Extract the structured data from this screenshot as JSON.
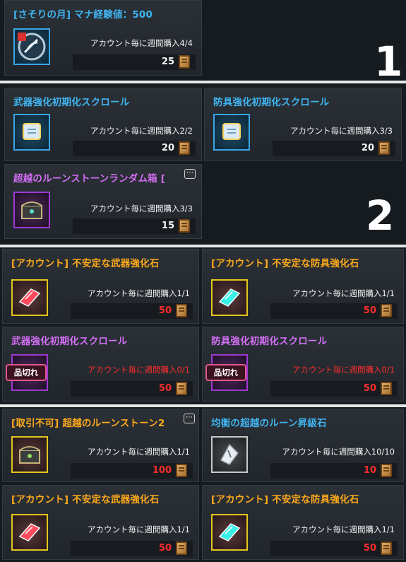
{
  "sections": [
    {
      "number": "1",
      "items": [
        {
          "title": "[さそりの月] マナ経験値：500",
          "color": "blue",
          "limit": "アカウント毎に週間購入4/4",
          "price": "25",
          "icon": "scorpion-moon-medal-icon"
        }
      ]
    },
    {
      "number": "2",
      "items": [
        {
          "title": "武器強化初期化スクロール",
          "color": "blue",
          "limit": "アカウント毎に週間購入2/2",
          "price": "20",
          "icon": "scroll-icon"
        },
        {
          "title": "防具強化初期化スクロール",
          "color": "blue",
          "limit": "アカウント毎に週間購入3/3",
          "price": "20",
          "icon": "scroll-icon"
        },
        {
          "title": "超越のルーンストーンランダム箱 [",
          "color": "purple",
          "limit": "アカウント毎に週間購入3/3",
          "price": "15",
          "icon": "treasure-chest-icon"
        }
      ]
    },
    {
      "items": [
        {
          "title": "[アカウント] 不安定な武器強化石",
          "color": "orange",
          "limit": "アカウント毎に週間購入1/1",
          "price": "50",
          "icon": "red-enhancement-stone-icon"
        },
        {
          "title": "[アカウント] 不安定な防具強化石",
          "color": "orange",
          "limit": "アカウント毎に週間購入1/1",
          "price": "50",
          "icon": "cyan-enhancement-stone-icon"
        },
        {
          "title": "武器強化初期化スクロール",
          "color": "purple",
          "limit": "アカウント毎に週間購入0/1",
          "price": "50",
          "icon": "scroll-icon",
          "sold_out": "品切れ"
        },
        {
          "title": "防具強化初期化スクロール",
          "color": "purple",
          "limit": "アカウント毎に週間購入0/1",
          "price": "50",
          "icon": "scroll-icon",
          "sold_out": "品切れ"
        }
      ]
    },
    {
      "items": [
        {
          "title": "[取引不可] 超越のルーンストーン2",
          "color": "orange",
          "limit": "アカウント毎に週間購入1/1",
          "price": "100",
          "icon": "treasure-chest-icon"
        },
        {
          "title": "均衡の超越のルーン昇級石",
          "color": "blue",
          "limit": "アカウント毎に週間購入10/10",
          "price": "10",
          "icon": "white-rune-stone-icon"
        },
        {
          "title": "[アカウント] 不安定な武器強化石",
          "color": "orange",
          "limit": "アカウント毎に週間購入1/1",
          "price": "50",
          "icon": "red-enhancement-stone-icon"
        },
        {
          "title": "[アカウント] 不安定な防具強化石",
          "color": "orange",
          "limit": "アカウント毎に週間購入1/1",
          "price": "50",
          "icon": "cyan-enhancement-stone-icon"
        }
      ]
    }
  ],
  "more_indicator": "⋯",
  "colors": {
    "blue": "#41b4f0",
    "orange": "#ffaa1a",
    "purple": "#d36ef5",
    "limit_red": "#ff2d2d",
    "currency": "#c98a3a"
  }
}
